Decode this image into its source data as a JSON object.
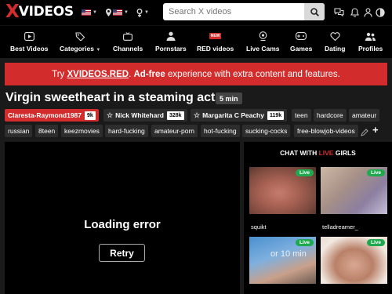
{
  "header": {
    "logo_x": "X",
    "logo_rest": "VIDEOS",
    "search_placeholder": "Search X videos"
  },
  "nav": [
    {
      "label": "Best Videos",
      "icon": "play-icon"
    },
    {
      "label": "Categories",
      "icon": "tags-icon",
      "has_caret": true
    },
    {
      "label": "Channels",
      "icon": "tv-icon"
    },
    {
      "label": "Pornstars",
      "icon": "star-person-icon"
    },
    {
      "label": "RED videos",
      "icon": "red-new-icon",
      "badge": "NEW"
    },
    {
      "label": "Live Cams",
      "icon": "webcam-icon"
    },
    {
      "label": "Games",
      "icon": "gamepad-icon"
    },
    {
      "label": "Dating",
      "icon": "heart-icon"
    },
    {
      "label": "Profiles",
      "icon": "people-icon"
    }
  ],
  "promo": {
    "prefix": "Try ",
    "link": "XVIDEOS.RED",
    "middle": ". ",
    "bold": "Ad-free",
    "suffix": " experience with extra content and features."
  },
  "video": {
    "title": "Virgin sweetheart in a steaming act",
    "duration": "5 min"
  },
  "uploader_tags": [
    {
      "name": "Claresta-Raymond1987",
      "count": "9k"
    },
    {
      "name": "Nick Whitehard",
      "count": "328k"
    },
    {
      "name": "Margarita C Peachy",
      "count": "119k"
    }
  ],
  "tags_row1": [
    "teen",
    "hardcore",
    "amateur"
  ],
  "tags_row2": [
    "russian",
    "8teen",
    "keezmovies",
    "hard-fucking",
    "amateur-porn",
    "hot-fucking",
    "sucking-cocks",
    "free-blowjob-videos"
  ],
  "player": {
    "error": "Loading error",
    "retry": "Retry"
  },
  "side": {
    "title_a": "CHAT WITH ",
    "title_live": "LIVE",
    "title_b": " GIRLS",
    "cams": [
      {
        "name": "squikt",
        "badge": "Live"
      },
      {
        "name": "telladreamer_",
        "badge": "Live"
      },
      {
        "name": "",
        "badge": "Live",
        "overlay": "or 10 min"
      },
      {
        "name": "",
        "badge": "Live"
      }
    ]
  },
  "colors": {
    "brand_red": "#d32c2c",
    "live_green": "#1fa94f",
    "bg": "#1a1a1a"
  }
}
